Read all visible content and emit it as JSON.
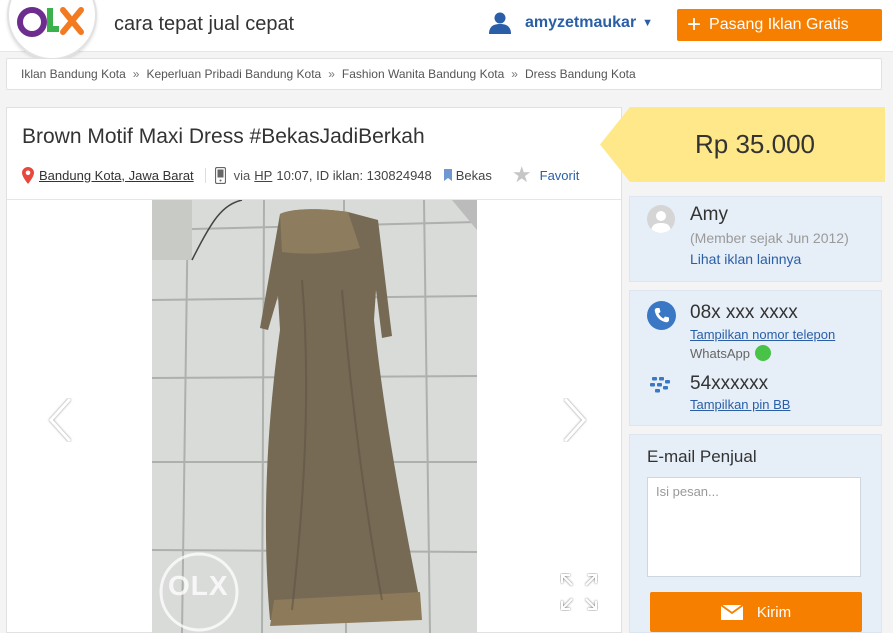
{
  "header": {
    "logo": "OLX",
    "tagline": "cara tepat jual cepat",
    "username": "amyzetmaukar",
    "post_button": "Pasang Iklan Gratis"
  },
  "breadcrumb": [
    "Iklan Bandung Kota",
    "Keperluan Pribadi Bandung Kota",
    "Fashion Wanita Bandung Kota",
    "Dress Bandung Kota"
  ],
  "breadcrumb_separator": "»",
  "ad": {
    "title": "Brown Motif Maxi Dress #BekasJadiBerkah",
    "location": "Bandung Kota, Jawa Barat",
    "via_prefix": "via",
    "via_device": "HP",
    "time_and_id": "10:07, ID iklan: 130824948",
    "condition": "Bekas",
    "favorite": "Favorit",
    "watermark": "OLX"
  },
  "price": "Rp 35.000",
  "seller": {
    "name": "Amy",
    "since": "(Member sejak Jun 2012)",
    "other_ads": "Lihat iklan lainnya"
  },
  "contact": {
    "phone": "08x xxx xxxx",
    "show_phone": "Tampilkan nomor telepon",
    "whatsapp": "WhatsApp",
    "bb_pin": "54xxxxxx",
    "show_pin": "Tampilkan pin BB"
  },
  "email": {
    "label": "E-mail Penjual",
    "placeholder": "Isi pesan...",
    "send": "Kirim"
  },
  "colors": {
    "accent_orange": "#f77f00",
    "link_blue": "#2a5fa8",
    "price_tag": "#ffe88a",
    "panel_bg": "#e6eef7"
  }
}
